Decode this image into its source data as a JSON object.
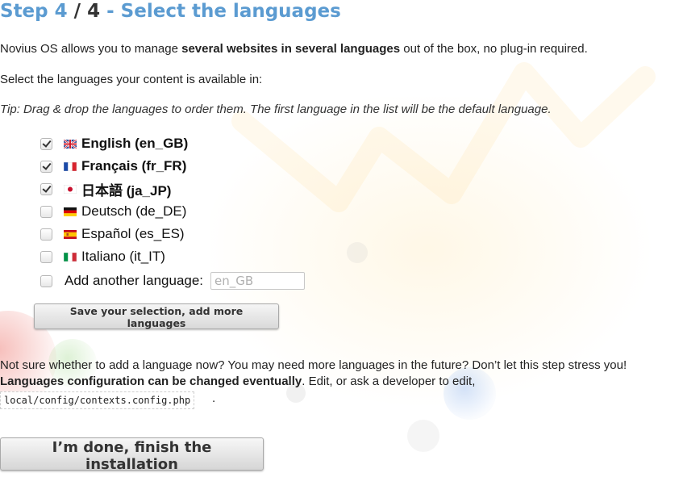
{
  "title": {
    "step": "Step 4",
    "separator": "/",
    "total": "4",
    "dash": "-",
    "heading": "Select the languages"
  },
  "intro": {
    "before": "Novius OS allows you to manage ",
    "bold": "several websites in several languages",
    "after": " out of the box, no plug-in required."
  },
  "select_text": "Select the languages your content is available in:",
  "tip": "Tip: Drag & drop the languages to order them. The first language in the list will be the default language.",
  "languages": [
    {
      "label": "English (en_GB)",
      "checked": true,
      "flag": "flag-gb-icon"
    },
    {
      "label": "Français (fr_FR)",
      "checked": true,
      "flag": "flag-fr-icon"
    },
    {
      "label": "日本語 (ja_JP)",
      "checked": true,
      "flag": "flag-jp-icon"
    },
    {
      "label": "Deutsch (de_DE)",
      "checked": false,
      "flag": "flag-de-icon"
    },
    {
      "label": "Español (es_ES)",
      "checked": false,
      "flag": "flag-es-icon"
    },
    {
      "label": "Italiano (it_IT)",
      "checked": false,
      "flag": "flag-it-icon"
    }
  ],
  "add_language": {
    "label": "Add another language:",
    "placeholder": "en_GB",
    "checked": false
  },
  "save_button": "Save your selection, add more languages",
  "note": {
    "line1": "Not sure whether to add a language now? You may need more languages in the future? Don’t let this step stress you!",
    "bold": "Languages configuration can be changed eventually",
    "after": ". Edit, or ask a developer to edit,",
    "code": "local/config/contexts.config.php",
    "code_after": "."
  },
  "done_button": "I’m done, finish the installation"
}
